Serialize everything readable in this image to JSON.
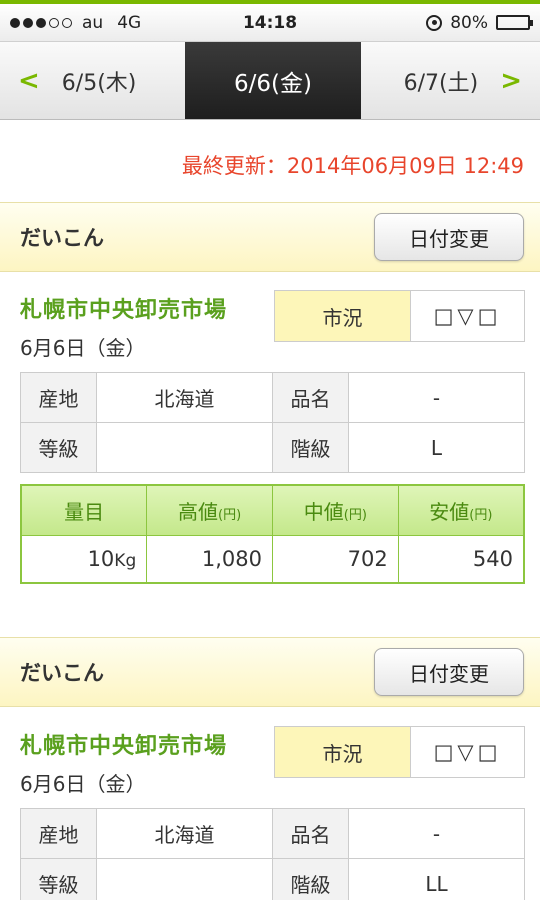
{
  "status": {
    "carrier": "au",
    "network": "4G",
    "time": "14:18",
    "battery": "80%",
    "battery_level": 0.8
  },
  "date_nav": {
    "prev": "6/5(木)",
    "current": "6/6(金)",
    "next": "6/7(土)"
  },
  "last_updated": "最終更新：2014年06月09日 12:49",
  "entries": [
    {
      "item": "だいこん",
      "change_button": "日付変更",
      "market": "札幌市中央卸売市場",
      "date": "6月6日（金）",
      "condition_label": "市況",
      "condition_value": "□▽□",
      "info": {
        "origin_label": "産地",
        "origin": "北海道",
        "variety_label": "品名",
        "variety": "-",
        "grade_label": "等級",
        "grade": "",
        "size_label": "階級",
        "size": "L"
      },
      "price_headers": {
        "qty": "量目",
        "high": "高値",
        "mid": "中値",
        "low": "安値",
        "unit": "(円)"
      },
      "prices": {
        "qty_num": "10",
        "qty_unit": "Kg",
        "high": "1,080",
        "mid": "702",
        "low": "540"
      }
    },
    {
      "item": "だいこん",
      "change_button": "日付変更",
      "market": "札幌市中央卸売市場",
      "date": "6月6日（金）",
      "condition_label": "市況",
      "condition_value": "□▽□",
      "info": {
        "origin_label": "産地",
        "origin": "北海道",
        "variety_label": "品名",
        "variety": "-",
        "grade_label": "等級",
        "grade": "",
        "size_label": "階級",
        "size": "LL"
      }
    }
  ],
  "colors": {
    "accent_green": "#7ab800",
    "market_green": "#5aa01e",
    "update_red": "#e8452c",
    "header_yellow": "#fdf5c2"
  }
}
